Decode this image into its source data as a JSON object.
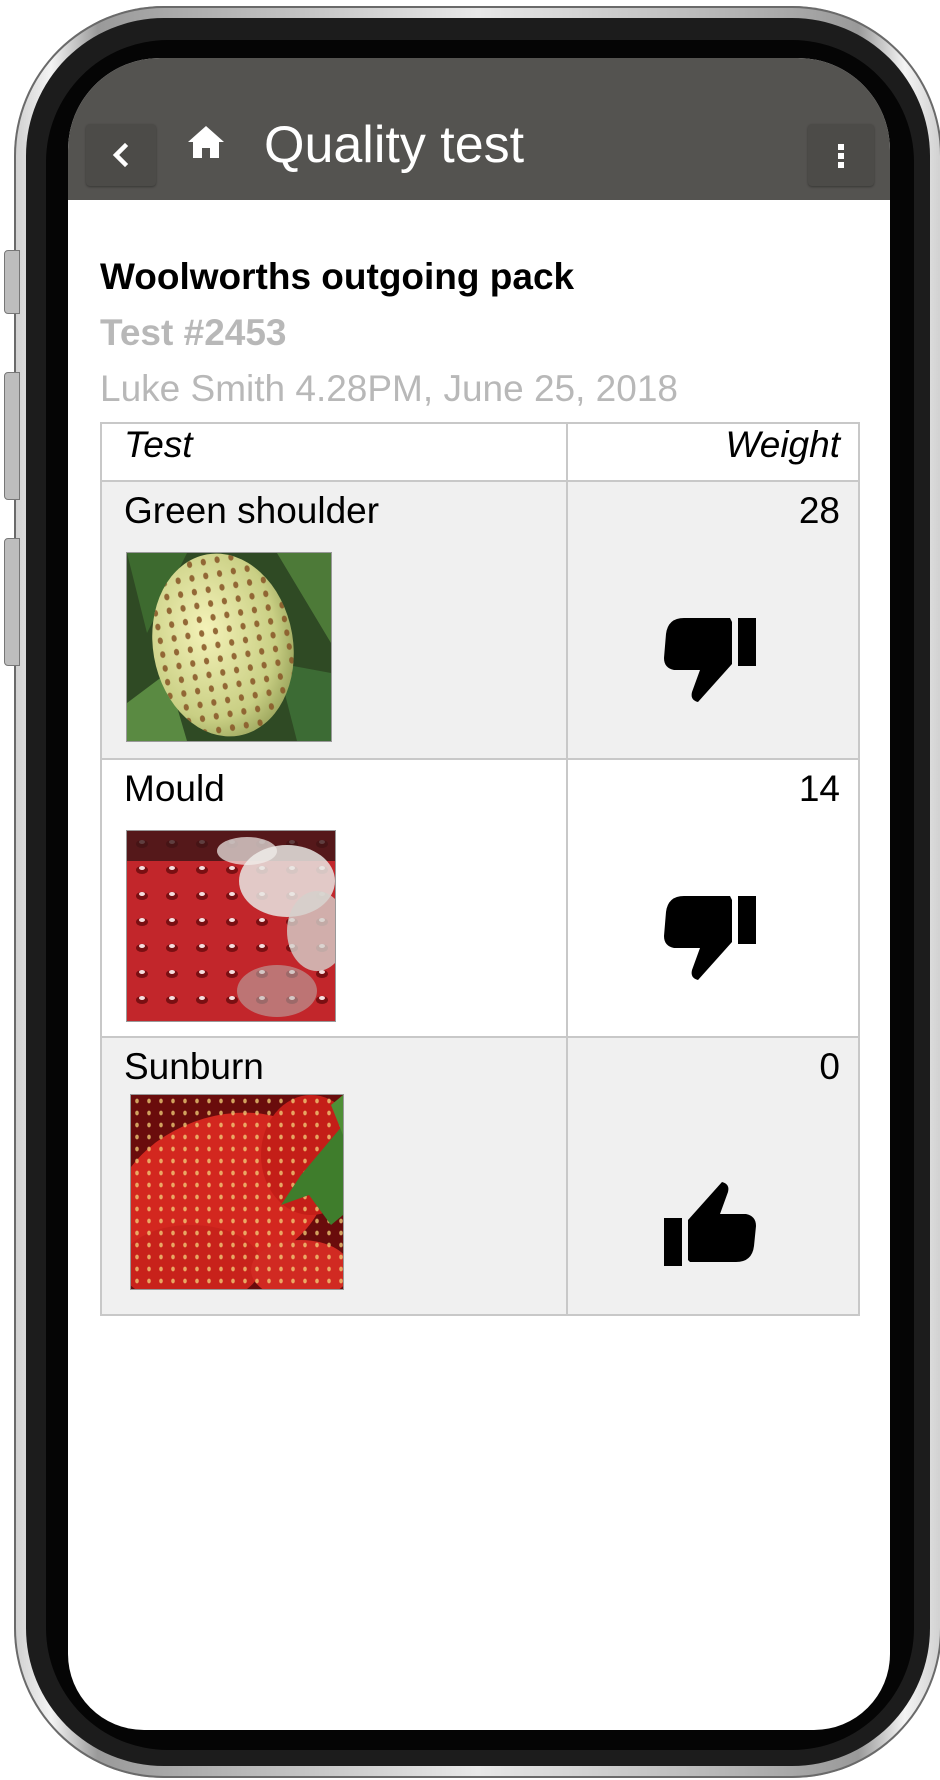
{
  "header": {
    "title": "Quality test",
    "back_icon": "chevron-left-icon",
    "home_icon": "home-icon",
    "menu_icon": "more-vertical-icon",
    "background": "#545350"
  },
  "pack": {
    "name": "Woolworths outgoing pack",
    "test_number": "Test #2453",
    "meta": "Luke Smith 4.28PM, June 25, 2018"
  },
  "table": {
    "columns": [
      "Test",
      "Weight"
    ],
    "rows": [
      {
        "test": "Green shoulder",
        "weight": "28",
        "verdict": "thumbs-down-icon",
        "photo": "unripe-strawberry-photo"
      },
      {
        "test": "Mould",
        "weight": "14",
        "verdict": "thumbs-down-icon",
        "photo": "mouldy-strawberry-photo"
      },
      {
        "test": "Sunburn",
        "weight": "0",
        "verdict": "thumbs-up-icon",
        "photo": "ripe-strawberries-photo"
      }
    ]
  },
  "colors": {
    "shaded_row": "#f0f0f0",
    "muted_text": "#b8b8b8",
    "grid": "#c8c8c8"
  }
}
